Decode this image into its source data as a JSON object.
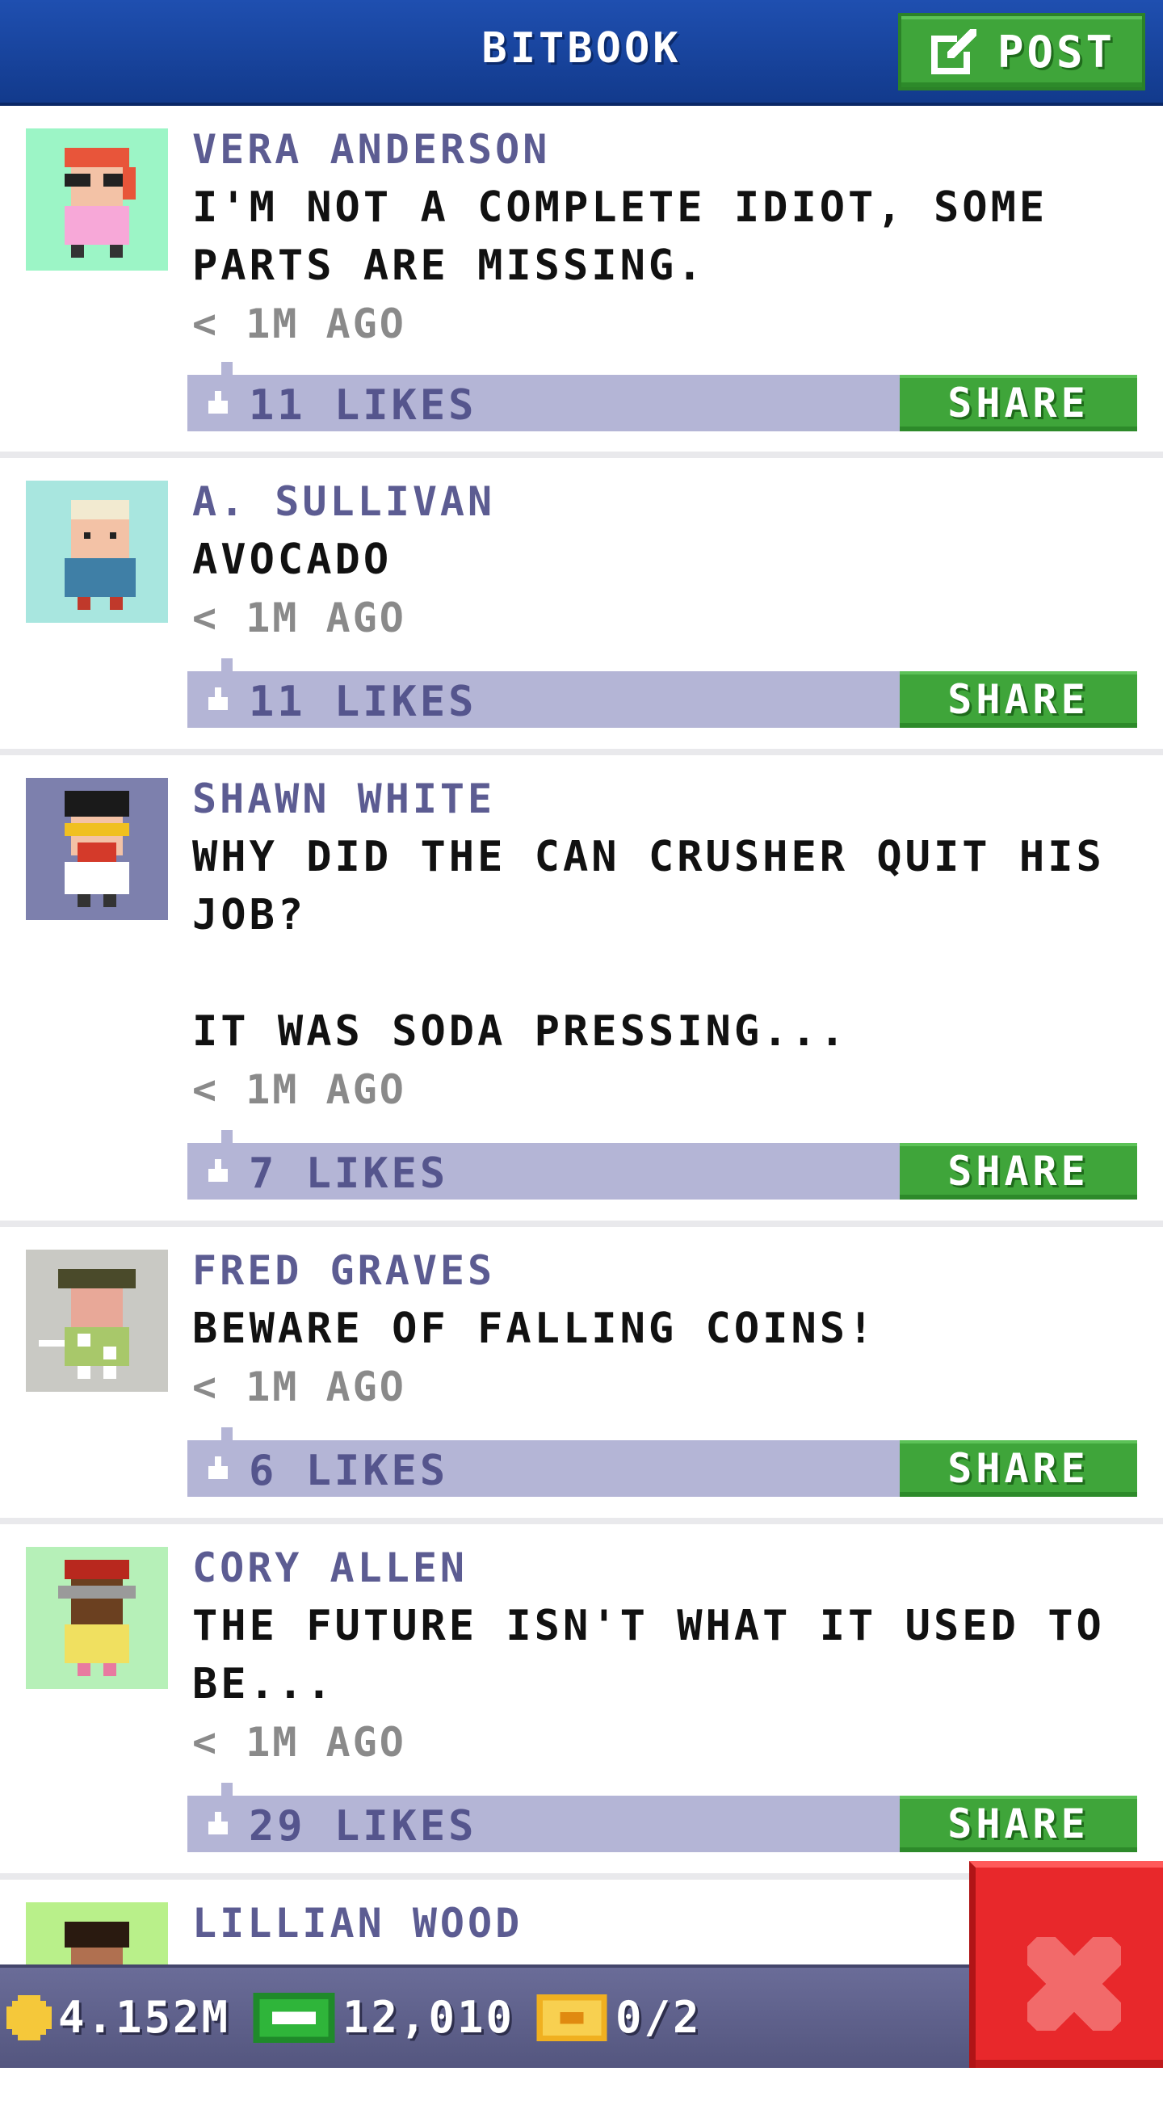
{
  "header": {
    "title": "BITBOOK",
    "post_label": "POST"
  },
  "posts": [
    {
      "name": "VERA ANDERSON",
      "message": "I'M NOT A COMPLETE IDIOT, SOME PARTS ARE MISSING.",
      "time": "< 1M AGO",
      "likes": "11 LIKES",
      "share": "SHARE",
      "avatar_bg": "#9cf5c6"
    },
    {
      "name": "A. SULLIVAN",
      "message": "AVOCADO",
      "time": "< 1M AGO",
      "likes": "11 LIKES",
      "share": "SHARE",
      "avatar_bg": "#a8e6df"
    },
    {
      "name": "SHAWN WHITE",
      "message": "WHY DID THE CAN CRUSHER QUIT HIS JOB?\n\nIT WAS SODA PRESSING...",
      "time": "< 1M AGO",
      "likes": "7 LIKES",
      "share": "SHARE",
      "avatar_bg": "#7d80ad"
    },
    {
      "name": "FRED GRAVES",
      "message": "BEWARE OF FALLING COINS!",
      "time": "< 1M AGO",
      "likes": "6 LIKES",
      "share": "SHARE",
      "avatar_bg": "#c9c9c4"
    },
    {
      "name": "CORY ALLEN",
      "message": "THE FUTURE ISN'T WHAT IT USED TO BE...",
      "time": "< 1M AGO",
      "likes": "29 LIKES",
      "share": "SHARE",
      "avatar_bg": "#b6f0b8"
    },
    {
      "name": "LILLIAN WOOD",
      "avatar_bg": "#b9f08a"
    }
  ],
  "status_bar": {
    "coins": "4.152M",
    "bux": "12,010",
    "tickets": "0/2"
  },
  "colors": {
    "header_blue": "#1a45a0",
    "share_green": "#3fa53a",
    "like_bar": "#b4b5d6",
    "close_red": "#e8282b"
  }
}
